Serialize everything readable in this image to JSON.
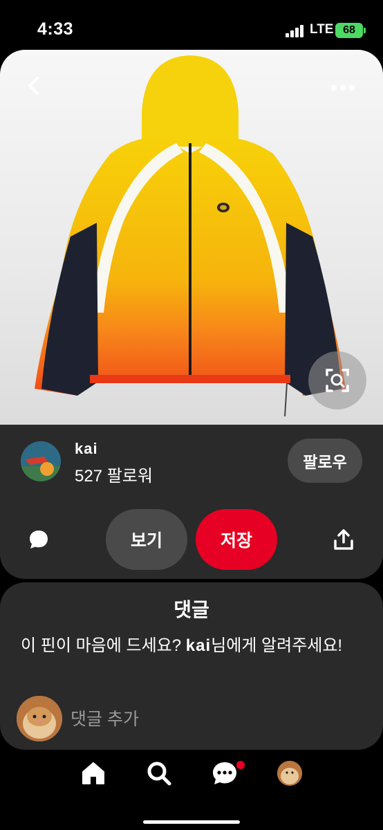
{
  "status_bar": {
    "time": "4:33",
    "network": "LTE",
    "battery": "68"
  },
  "pin": {
    "image_subject": "yellow-orange gradient zip-up hooded windbreaker jacket with white and black side panels",
    "creator": {
      "name": "kai",
      "followers": "527 팔로워"
    },
    "follow_label": "팔로우",
    "view_label": "보기",
    "save_label": "저장"
  },
  "comments": {
    "title": "댓글",
    "prompt_before": "이 핀이 마음에 드세요? ",
    "prompt_name": "kai",
    "prompt_after": "님에게 알려주세요!",
    "add_placeholder": "댓글 추가"
  },
  "colors": {
    "save": "#e60023",
    "card": "#2a2a2a",
    "battery": "#4cd964"
  },
  "icons": [
    "back-icon",
    "more-icon",
    "visual-search-icon",
    "comment-icon",
    "share-icon",
    "home-icon",
    "search-icon",
    "messages-icon"
  ]
}
